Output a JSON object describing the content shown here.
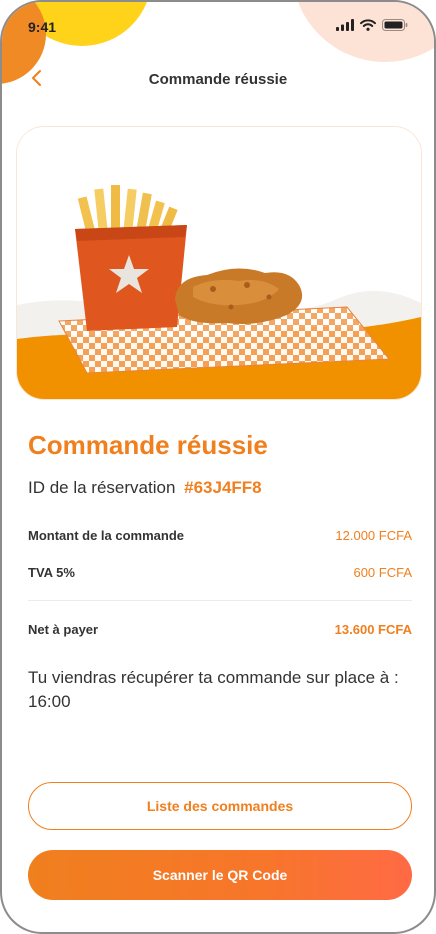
{
  "status_bar": {
    "time": "9:41",
    "icons": [
      "signal-icon",
      "wifi-icon",
      "battery-icon"
    ]
  },
  "header": {
    "back_icon": "chevron-left-icon",
    "title": "Commande réussie"
  },
  "hero": {
    "image": "fries-and-fried-chicken-on-checkered-paper"
  },
  "order": {
    "title": "Commande réussie",
    "reservation_label": "ID de la réservation",
    "reservation_id": "#63J4FF8",
    "rows": [
      {
        "label": "Montant de la commande",
        "value": "12.000 FCFA"
      },
      {
        "label": "TVA 5%",
        "value": "600 FCFA"
      }
    ],
    "net": {
      "label": "Net à payer",
      "value": "13.600 FCFA"
    },
    "pickup_text": "Tu viendras récupérer ta commande sur place à : 16:00"
  },
  "actions": {
    "orders_list_label": "Liste des commandes",
    "scan_qr_label": "Scanner le QR Code"
  },
  "colors": {
    "accent": "#f07f1e",
    "accent_end": "#ff6a45",
    "text": "#333333",
    "blob_yellow": "#ffd31a",
    "blob_peach": "#fde3d5"
  }
}
